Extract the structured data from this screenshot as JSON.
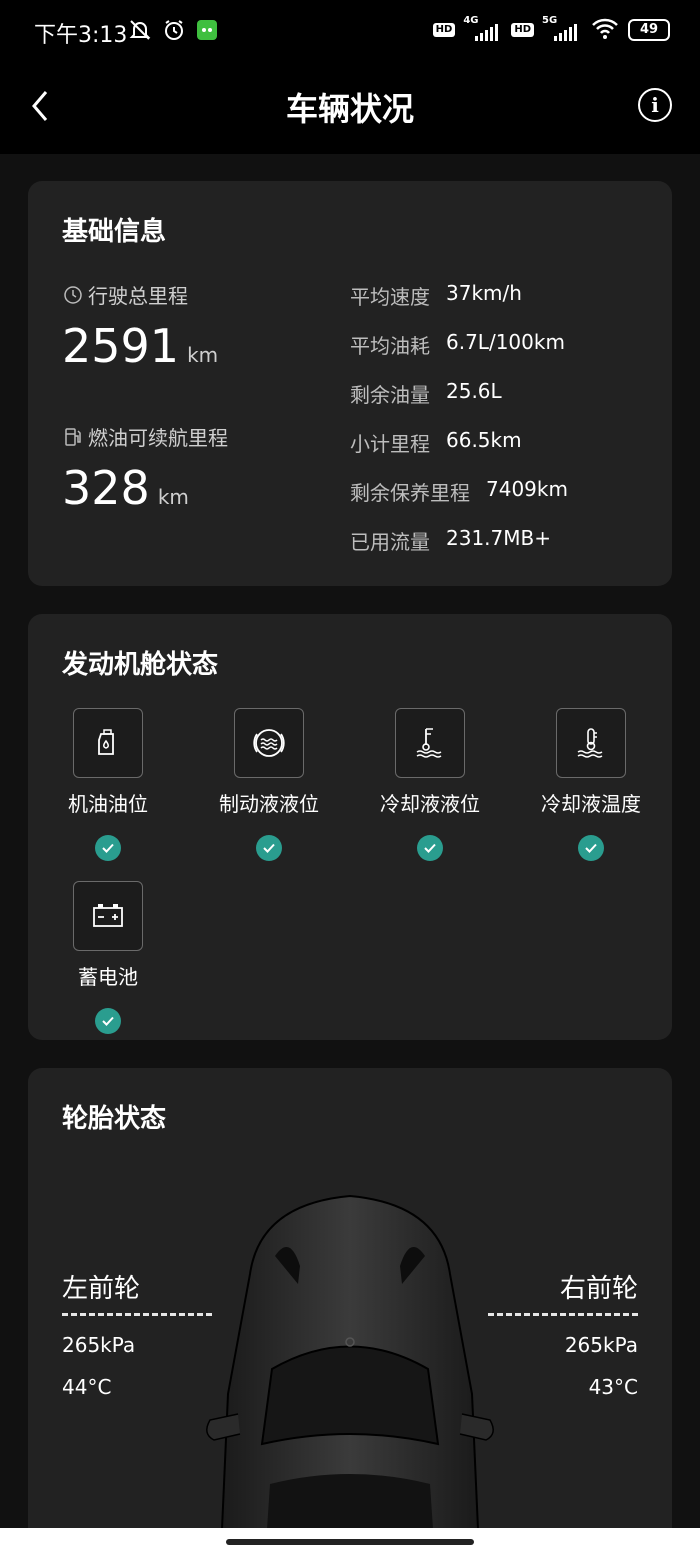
{
  "status_bar": {
    "time": "下午3:13",
    "network_1": "4G",
    "network_2": "5G",
    "hd_label": "HD",
    "battery": "49"
  },
  "header": {
    "title": "车辆状况"
  },
  "basic_info": {
    "title": "基础信息",
    "total_mileage": {
      "label": "行驶总里程",
      "value": "2591",
      "unit": "km"
    },
    "fuel_range": {
      "label": "燃油可续航里程",
      "value": "328",
      "unit": "km"
    },
    "stats": [
      {
        "label": "平均速度",
        "value": "37km/h"
      },
      {
        "label": "平均油耗",
        "value": "6.7L/100km"
      },
      {
        "label": "剩余油量",
        "value": "25.6L"
      },
      {
        "label": "小计里程",
        "value": "66.5km"
      },
      {
        "label": "剩余保养里程",
        "value": "7409km"
      },
      {
        "label": "已用流量",
        "value": "231.7MB+"
      }
    ]
  },
  "engine": {
    "title": "发动机舱状态",
    "items": [
      {
        "label": "机油油位",
        "icon": "oil-can-icon",
        "status": "ok"
      },
      {
        "label": "制动液液位",
        "icon": "brake-fluid-icon",
        "status": "ok"
      },
      {
        "label": "冷却液液位",
        "icon": "coolant-level-icon",
        "status": "ok"
      },
      {
        "label": "冷却液温度",
        "icon": "coolant-temperature-icon",
        "status": "ok"
      },
      {
        "label": "蓄电池",
        "icon": "battery-icon",
        "status": "ok"
      }
    ]
  },
  "tires": {
    "title": "轮胎状态",
    "front_left": {
      "label": "左前轮",
      "pressure": "265kPa",
      "temp": "44°C"
    },
    "front_right": {
      "label": "右前轮",
      "pressure": "265kPa",
      "temp": "43°C"
    }
  },
  "colors": {
    "ok_badge": "#2a9d8f",
    "card": "#222222",
    "background": "#111111"
  }
}
